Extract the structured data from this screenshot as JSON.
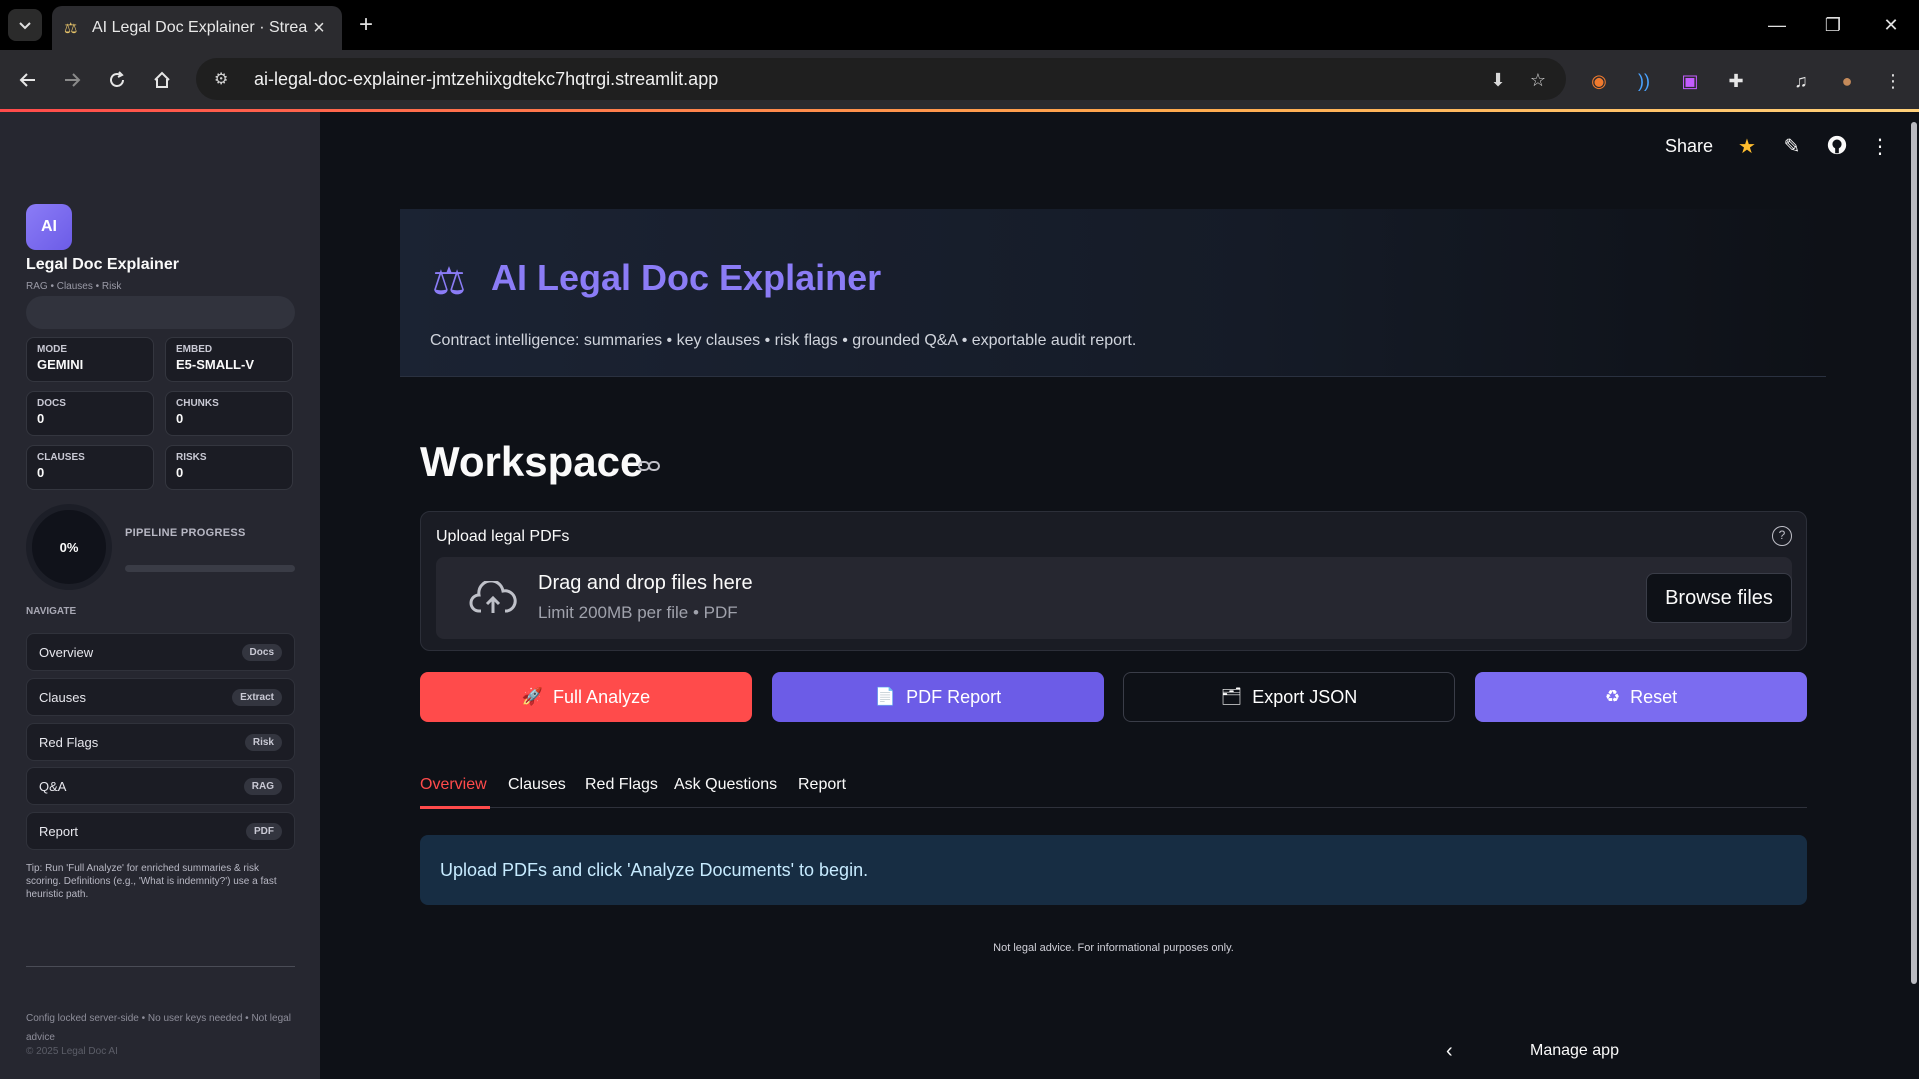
{
  "browser": {
    "tab_title": "AI Legal Doc Explainer · Streamlit",
    "url": "ai-legal-doc-explainer-jmtzehiixgdtekc7hqtrgi.streamlit.app"
  },
  "sidebar": {
    "logo": "AI",
    "title": "Legal Doc Explainer",
    "subtitle": "RAG • Clauses • Risk",
    "stats": [
      {
        "label": "MODE",
        "value": "GEMINI"
      },
      {
        "label": "EMBED",
        "value": "E5-SMALL-V"
      },
      {
        "label": "DOCS",
        "value": "0"
      },
      {
        "label": "CHUNKS",
        "value": "0"
      },
      {
        "label": "CLAUSES",
        "value": "0"
      },
      {
        "label": "RISKS",
        "value": "0"
      }
    ],
    "progress_pct_text": "0%",
    "progress_value": 0,
    "progress_label": "PIPELINE PROGRESS",
    "navigate_label": "NAVIGATE",
    "nav": [
      {
        "label": "Overview",
        "badge": "Docs"
      },
      {
        "label": "Clauses",
        "badge": "Extract"
      },
      {
        "label": "Red Flags",
        "badge": "Risk"
      },
      {
        "label": "Q&A",
        "badge": "RAG"
      },
      {
        "label": "Report",
        "badge": "PDF"
      }
    ],
    "tip": "Tip: Run 'Full Analyze' for enriched summaries & risk scoring. Definitions (e.g., 'What is indemnity?') use a fast heuristic path.",
    "footer": "Config locked server-side • No user keys needed • Not legal advice",
    "copyright": "© 2025 Legal Doc AI"
  },
  "toolbar": {
    "share": "Share"
  },
  "hero": {
    "title": "AI Legal Doc Explainer",
    "subtitle": "Contract intelligence: summaries • key clauses • risk flags • grounded Q&A • exportable audit report."
  },
  "workspace": {
    "title": "Workspace",
    "upload_label": "Upload legal PDFs",
    "drop_title": "Drag and drop files here",
    "drop_sub": "Limit 200MB per file • PDF",
    "browse": "Browse files"
  },
  "actions": [
    {
      "label": "Full Analyze",
      "icon": "🚀"
    },
    {
      "label": "PDF Report",
      "icon": "📄"
    },
    {
      "label": "Export JSON",
      "icon": "🗂"
    },
    {
      "label": "Reset",
      "icon": "♻"
    }
  ],
  "tabs": [
    "Overview",
    "Clauses",
    "Red Flags",
    "Ask Questions",
    "Report"
  ],
  "info_message": "Upload PDFs and click 'Analyze Documents' to begin.",
  "disclaimer": "Not legal advice. For informational purposes only.",
  "manage_app": "Manage app",
  "colors": {
    "accent_red": "#ff4b4b",
    "accent_purple": "#8b7cf6"
  }
}
